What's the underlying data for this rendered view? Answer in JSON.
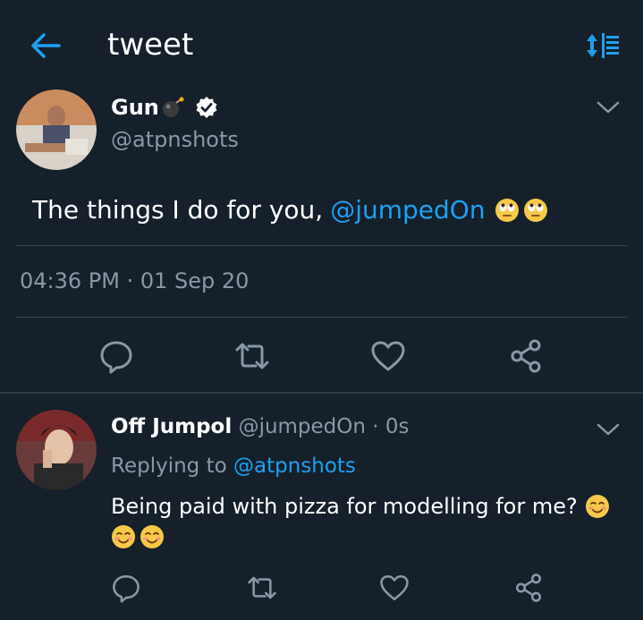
{
  "header": {
    "title": "tweet"
  },
  "tweet": {
    "author_name": "Gun",
    "author_handle": "@atpnshots",
    "text": "The things I do for you,",
    "mention": "@jumpedOn",
    "timestamp": "04:36 PM · 01 Sep 20"
  },
  "reply": {
    "author_name": "Off Jumpol",
    "meta": "@jumpedOn · 0s",
    "replying_prefix": "Replying to",
    "replying_to": "@atpnshots",
    "text": "Being paid with pizza for modelling for me?"
  },
  "colors": {
    "background": "#15202b",
    "accent": "#1da1f2",
    "secondary_text": "#8899a6",
    "divider": "#38444d"
  },
  "icons": {
    "back": "back-arrow-icon",
    "sort": "sort-icon",
    "verified": "verified-badge-icon",
    "bomb": "bomb-emoji-icon",
    "chevron": "chevron-down-icon",
    "reply": "comment-icon",
    "retweet": "retweet-icon",
    "like": "heart-icon",
    "share": "share-icon",
    "eye_roll": "face-with-rolling-eyes-emoji",
    "smile": "smiling-face-emoji"
  }
}
